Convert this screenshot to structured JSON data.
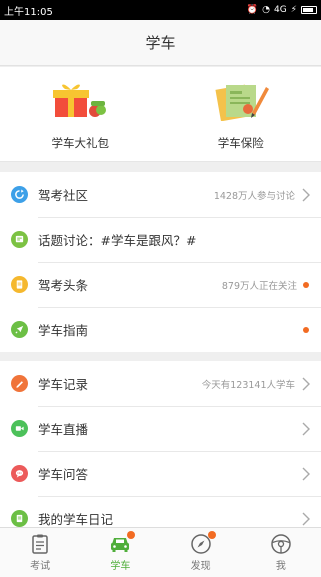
{
  "status_bar": {
    "time": "上午11:05",
    "network": "4G"
  },
  "header": {
    "title": "学车"
  },
  "promo": [
    {
      "label": "学车大礼包",
      "icon": "gift-icon"
    },
    {
      "label": "学车保险",
      "icon": "insurance-document-icon"
    }
  ],
  "list_a": [
    {
      "label": "驾考社区",
      "meta": "1428万人参与讨论",
      "icon": "refresh-icon",
      "color": "#3da0e8",
      "trailing": "chevron"
    },
    {
      "label": "话题讨论：#学车是跟风？#",
      "meta": "",
      "icon": "topic-icon",
      "color": "#7cc243",
      "trailing": "none"
    },
    {
      "label": "驾考头条",
      "meta": "879万人正在关注",
      "icon": "document-icon",
      "color": "#f5b82e",
      "trailing": "dot"
    },
    {
      "label": "学车指南",
      "meta": "",
      "icon": "rocket-icon",
      "color": "#6cbf45",
      "trailing": "dot"
    }
  ],
  "list_b": [
    {
      "label": "学车记录",
      "meta": "今天有123141人学车",
      "icon": "pencil-icon",
      "color": "#f0743a",
      "trailing": "chevron"
    },
    {
      "label": "学车直播",
      "meta": "",
      "icon": "video-icon",
      "color": "#4cc15a",
      "trailing": "chevron"
    },
    {
      "label": "学车问答",
      "meta": "",
      "icon": "chat-icon",
      "color": "#ec5a5a",
      "trailing": "chevron"
    },
    {
      "label": "我的学车日记",
      "meta": "",
      "icon": "diary-icon",
      "color": "#6cbf45",
      "trailing": "chevron"
    }
  ],
  "tabs": [
    {
      "label": "考试",
      "icon": "clipboard-icon",
      "active": false,
      "badge": false
    },
    {
      "label": "学车",
      "icon": "car-icon",
      "active": true,
      "badge": true
    },
    {
      "label": "发现",
      "icon": "compass-icon",
      "active": false,
      "badge": true
    },
    {
      "label": "我",
      "icon": "steering-wheel-icon",
      "active": false,
      "badge": false
    }
  ],
  "colors": {
    "accent_green": "#4fae3a",
    "badge_orange": "#f26b22",
    "background": "#efefef"
  }
}
